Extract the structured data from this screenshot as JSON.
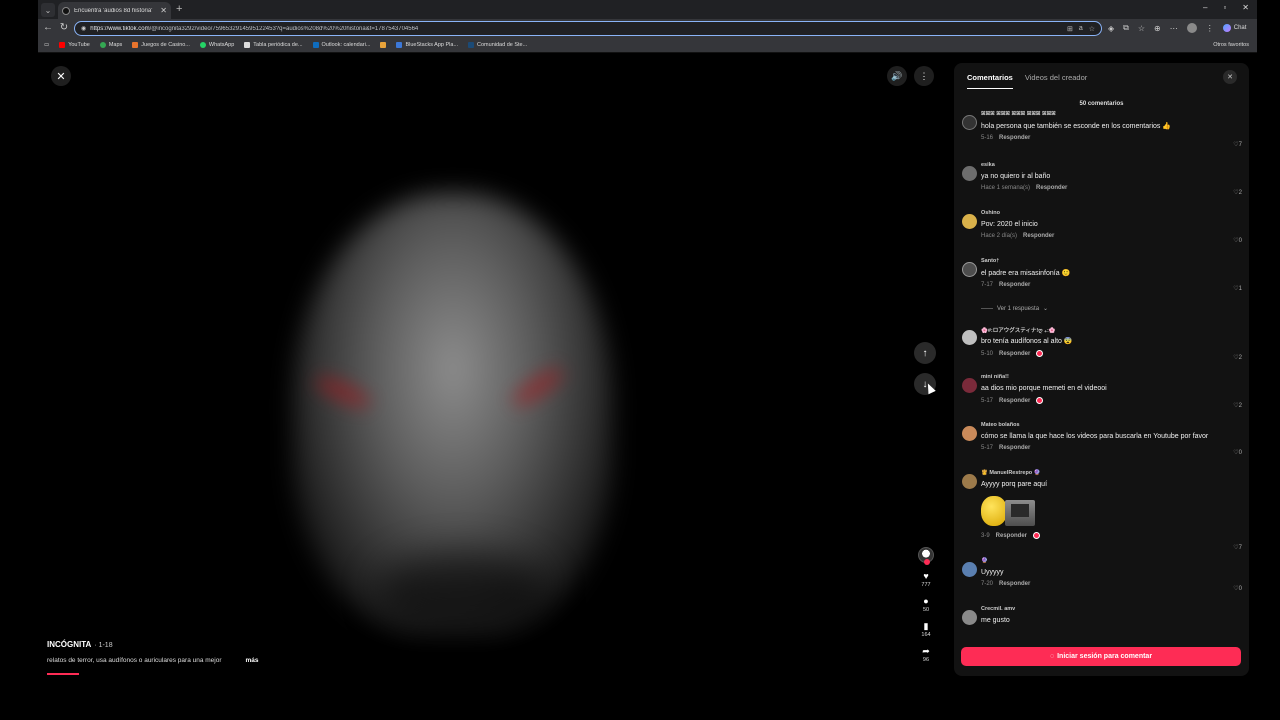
{
  "browser": {
    "tab_title": "Encuentra 'audios 8d historia'",
    "url_host": "https://www.tiktok.com",
    "url_path": "/@incognita3292/video/7596532914595122453?q=audios%208d%20%20historia&t=1787543704564",
    "chat_label": "Chat",
    "bookmarks": [
      "YouTube",
      "Maps",
      "Juegos de Casino...",
      "WhatsApp",
      "Tabla periódica de...",
      "Outlook: calendari...",
      "BlueStacks App Pla...",
      "Comunidad de Ste..."
    ],
    "other_bookmarks": "Otros favoritos"
  },
  "video": {
    "author": "INCÓGNITA",
    "duration": "· 1-18",
    "description": "relatos de terror, usa audífonos o auriculares para una mejor",
    "more_label": "más",
    "likes": "777",
    "comments": "50",
    "saves": "164",
    "shares": "96"
  },
  "panel": {
    "tab_comments": "Comentarios",
    "tab_creator": "Videos del creador",
    "count": "50 comentarios",
    "view_replies": "Ver 1 respuesta",
    "reply_label": "Responder",
    "login_label": "Iniciar sesión para comentar",
    "comments": [
      {
        "user": "ꕤꕤꕤ ꕤꕤꕤ ꕤꕤꕤ ꕤꕤꕤ ꕤꕤꕤ",
        "text": "hola persona que también se esconde en los comentarios 👍",
        "date": "5-16",
        "likes": "7"
      },
      {
        "user": "esika",
        "text": "ya no quiero ir al baño",
        "date": "Hace 1 semana(s)",
        "likes": "2"
      },
      {
        "user": "Oshino",
        "text": "Pov: 2020 el inicio",
        "date": "Hace 2 día(s)",
        "likes": "0"
      },
      {
        "user": "Santo†",
        "text": "el padre era misasinfonía 🙂",
        "date": "7-17",
        "likes": "1"
      },
      {
        "user": "🌸#:ロアウグスティナ!ღ ₊:🌸",
        "text": "bro tenía audífonos al alto 😨",
        "date": "5-10",
        "likes": "2"
      },
      {
        "user": "mini niña!!",
        "text": "aa dios mio porque memeti en el videooi",
        "date": "5-17",
        "likes": "2"
      },
      {
        "user": "Mateo bolaños",
        "text": "cómo se llama la que hace los videos para buscarla en Youtube por favor",
        "date": "5-17",
        "likes": "0"
      },
      {
        "user": "👸 ManuelRestrepo 🔮",
        "text": "Ayyyy porq pare aquí",
        "date": "3-9",
        "likes": "7"
      },
      {
        "user": "🔮",
        "text": "Uyyyyy",
        "date": "7-20",
        "likes": "0"
      },
      {
        "user": "Crecmil. amv",
        "text": "me gusto",
        "date": "",
        "likes": ""
      }
    ]
  },
  "colors": {
    "accent": "#fe2c55",
    "panel_bg": "#121212",
    "chrome_bg": "#35363a"
  }
}
